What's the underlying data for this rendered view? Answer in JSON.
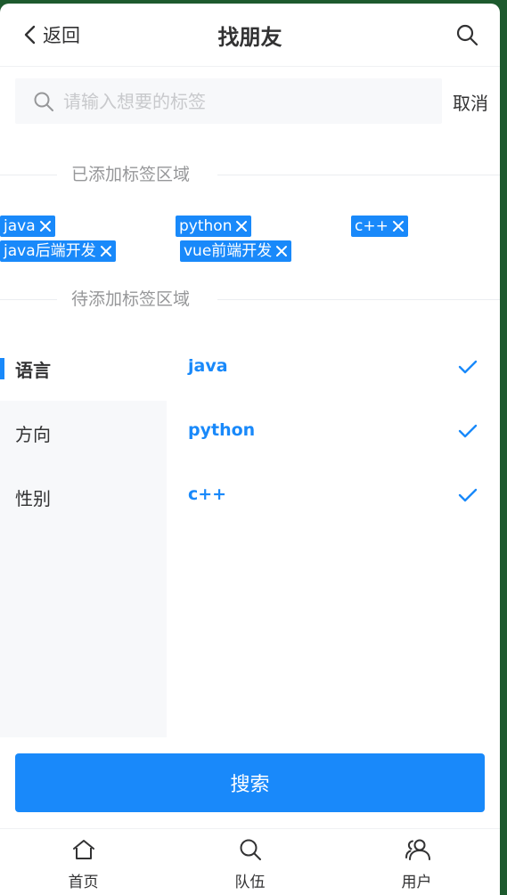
{
  "navbar": {
    "back_label": "返回",
    "title": "找朋友"
  },
  "search": {
    "placeholder": "请输入想要的标签",
    "value": "",
    "cancel_label": "取消"
  },
  "added_section": {
    "label": "已添加标签区域",
    "tags": [
      "java",
      "python",
      "c++",
      "java后端开发",
      "vue前端开发"
    ]
  },
  "pending_section": {
    "label": "待添加标签区域"
  },
  "tree": {
    "categories": [
      "语言",
      "方向",
      "性别"
    ],
    "active_category": "语言",
    "options": [
      "java",
      "python",
      "c++"
    ]
  },
  "search_button_label": "搜索",
  "tabbar": {
    "tabs": [
      "首页",
      "队伍",
      "用户"
    ]
  },
  "colors": {
    "accent": "#1989fa",
    "text": "#323233",
    "muted": "#969799",
    "frame": "#1d5a2e"
  }
}
